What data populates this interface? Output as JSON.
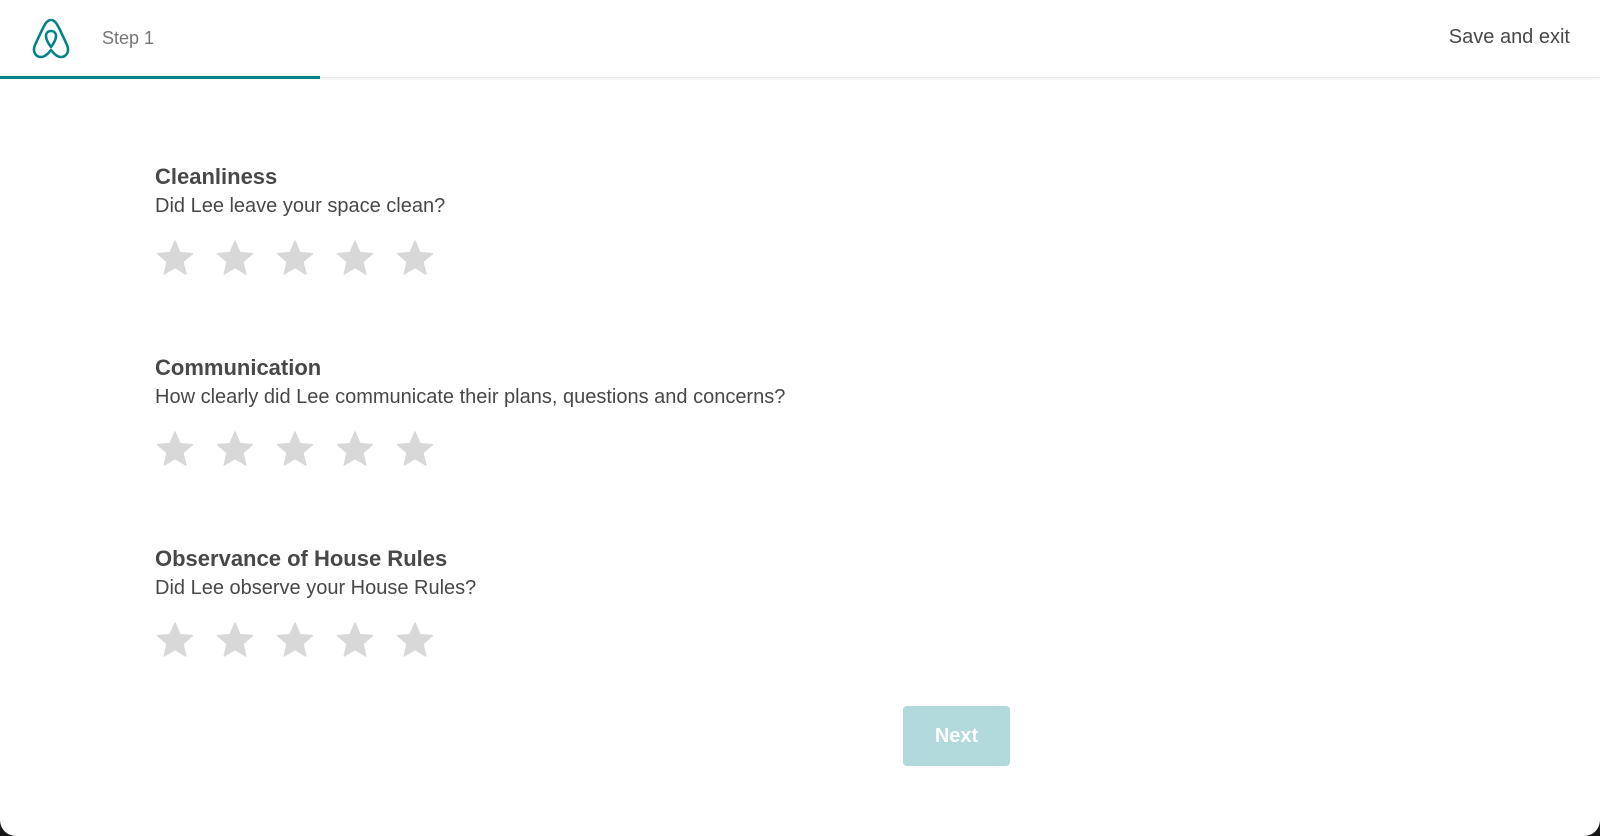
{
  "header": {
    "logo_icon": "airbnb-logo-icon",
    "step_label": "Step 1",
    "save_exit_label": "Save and exit",
    "progress_fraction": 0.2
  },
  "colors": {
    "accent": "#008489",
    "star_empty": "#d8d8d8",
    "button_disabled": "#b2dadc",
    "text": "#484848",
    "muted": "#767676"
  },
  "sections": [
    {
      "title": "Cleanliness",
      "question": "Did Lee leave your space clean?",
      "rating": 0,
      "max_rating": 5
    },
    {
      "title": "Communication",
      "question": "How clearly did Lee communicate their plans, questions and concerns?",
      "rating": 0,
      "max_rating": 5
    },
    {
      "title": "Observance of House Rules",
      "question": "Did Lee observe your House Rules?",
      "rating": 0,
      "max_rating": 5
    }
  ],
  "footer": {
    "next_label": "Next",
    "next_disabled": true
  }
}
